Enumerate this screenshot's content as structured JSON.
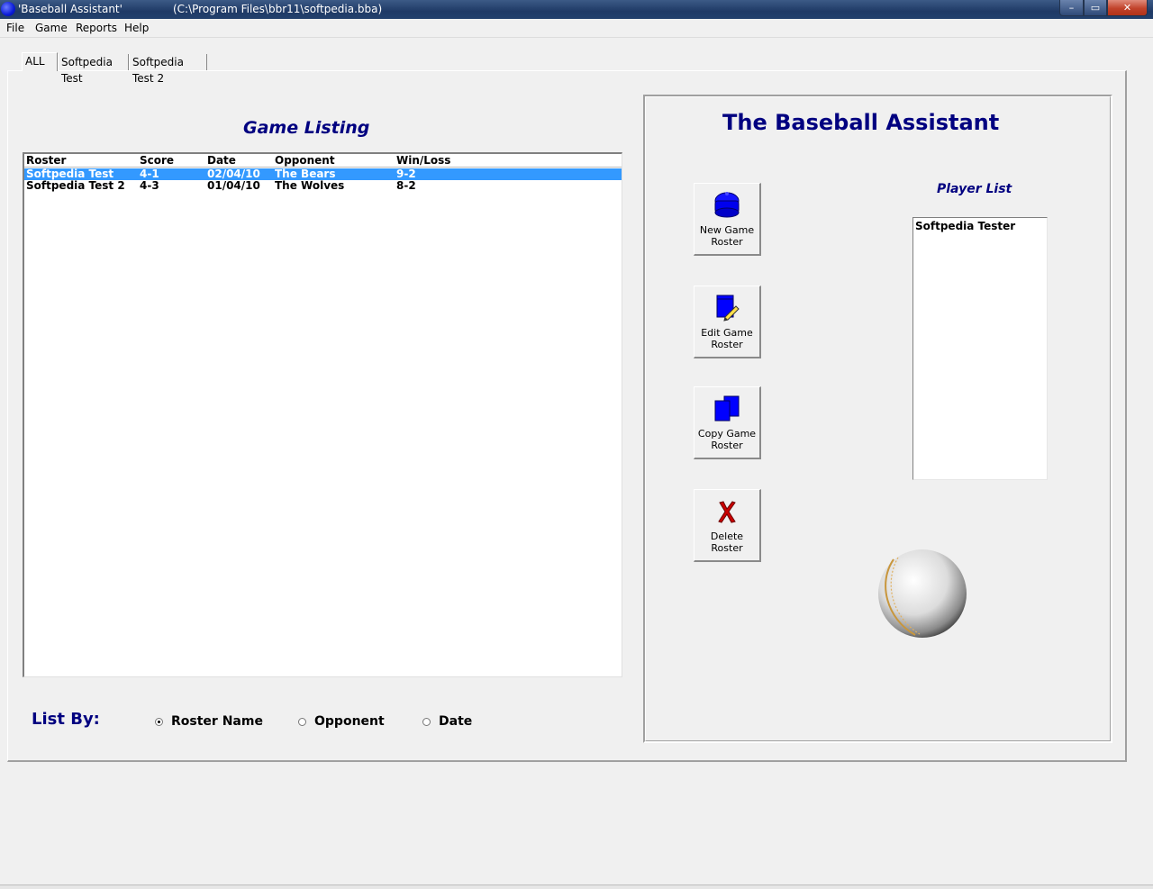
{
  "window": {
    "title": "'Baseball Assistant'",
    "path": "(C:\\Program Files\\bbr11\\softpedia.bba)",
    "minimize_glyph": "–",
    "maximize_glyph": "▭",
    "close_glyph": "✕"
  },
  "menu": [
    "File",
    "Game",
    "Reports",
    "Help"
  ],
  "tabs": [
    "ALL",
    "Softpedia Test",
    "Softpedia Test 2"
  ],
  "game_listing": {
    "title": "Game Listing",
    "columns": [
      "Roster",
      "Score",
      "Date",
      "Opponent",
      "Win/Loss"
    ],
    "rows": [
      {
        "roster": "Softpedia Test",
        "score": "4-1",
        "date": "02/04/10",
        "opponent": "The Bears",
        "winloss": "9-2"
      },
      {
        "roster": "Softpedia Test 2",
        "score": "4-3",
        "date": "01/04/10",
        "opponent": "The Wolves",
        "winloss": "8-2"
      }
    ]
  },
  "list_by": {
    "label": "List By:",
    "options": [
      "Roster Name",
      "Opponent",
      "Date"
    ],
    "selected": "Roster Name"
  },
  "app_title": "The Baseball Assistant",
  "buttons": {
    "new_roster": "New Game\nRoster",
    "edit_roster": "Edit Game\nRoster",
    "copy_roster": "Copy Game\nRoster",
    "delete_roster": "Delete\nRoster"
  },
  "player_list": {
    "title": "Player List",
    "items": [
      "Softpedia Tester"
    ]
  },
  "colors": {
    "accent_navy": "#000080",
    "selection_blue": "#3399ff",
    "icon_blue": "#0000ff",
    "delete_red": "#cc0000"
  }
}
